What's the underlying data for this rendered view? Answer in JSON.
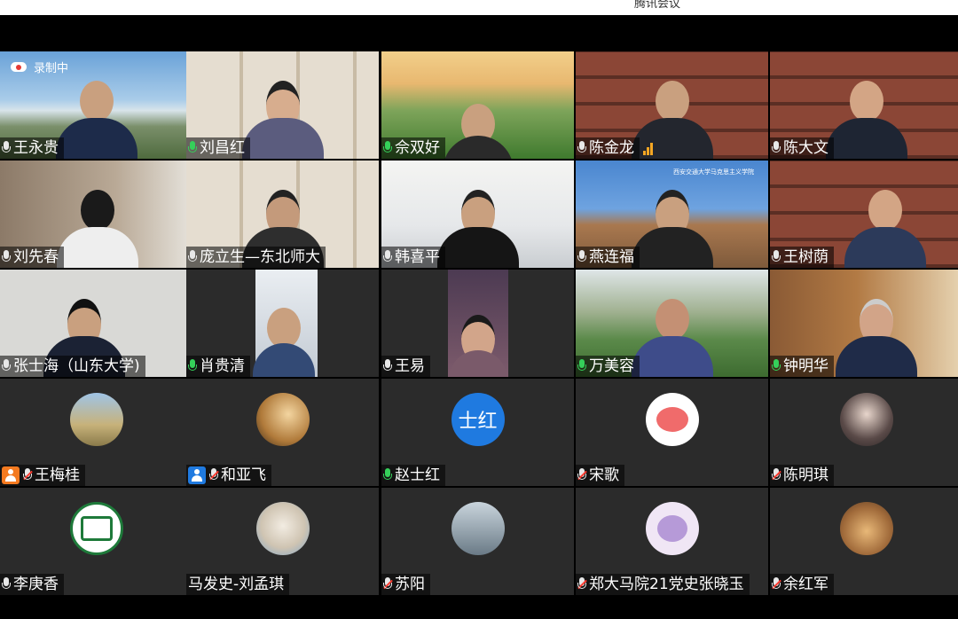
{
  "window": {
    "title": "腾讯会议"
  },
  "recording": {
    "label": "录制中"
  },
  "colors": {
    "mic_on": "#35d05a",
    "mic_muted_slash": "#ff3b30",
    "active_border": "#34d058",
    "empty_tile": "#2b2b2b",
    "badge_orange": "#f47a20",
    "badge_blue": "#1f7ae0"
  },
  "participants": [
    {
      "name": "王永贵",
      "mic": "off-white",
      "video": true
    },
    {
      "name": "刘昌红",
      "mic": "on",
      "video": true
    },
    {
      "name": "佘双好",
      "mic": "on",
      "video": true
    },
    {
      "name": "陈金龙",
      "mic": "off-white",
      "video": true
    },
    {
      "name": "陈大文",
      "mic": "off-white",
      "video": true
    },
    {
      "name": "刘先春",
      "mic": "off-white",
      "video": true
    },
    {
      "name": "庞立生—东北师大",
      "mic": "off-white",
      "video": true
    },
    {
      "name": "韩喜平",
      "mic": "off-white",
      "video": true,
      "active": true
    },
    {
      "name": "燕连福",
      "mic": "off-white",
      "video": true,
      "banner": "西安交通大学马克思主义学院"
    },
    {
      "name": "王树荫",
      "mic": "off-white",
      "video": true
    },
    {
      "name": "张士海（山东大学)",
      "mic": "off-white",
      "video": true
    },
    {
      "name": "肖贵清",
      "mic": "on",
      "video": true
    },
    {
      "name": "王易",
      "mic": "off-white",
      "video": true
    },
    {
      "name": "万美容",
      "mic": "on",
      "video": true
    },
    {
      "name": "钟明华",
      "mic": "on",
      "video": true
    },
    {
      "name": "王梅桂",
      "mic": "muted",
      "video": false,
      "avatar": "photo-landscape-icon",
      "badge": "orange"
    },
    {
      "name": "和亚飞",
      "mic": "muted",
      "video": false,
      "avatar": "photo-silhouette-icon",
      "badge": "blue"
    },
    {
      "name": "赵士红",
      "mic": "on",
      "video": false,
      "avatar_text": "士红",
      "avatar_color": "#1f7ae0"
    },
    {
      "name": "宋歌",
      "mic": "muted",
      "video": false,
      "avatar": "pig-sticker-icon"
    },
    {
      "name": "陈明琪",
      "mic": "muted",
      "video": false,
      "avatar": "photo-portrait-icon"
    },
    {
      "name": "李庚香",
      "mic": "off-white",
      "video": false,
      "avatar": "green-logo-icon"
    },
    {
      "name": "马发史-刘孟琪",
      "mic": "none",
      "video": false,
      "avatar": "alpaca-photo-icon"
    },
    {
      "name": "苏阳",
      "mic": "muted",
      "video": false,
      "avatar": "lake-photo-icon"
    },
    {
      "name": "郑大马院21党史张晓玉",
      "mic": "muted",
      "video": false,
      "avatar": "rabbit-cartoon-icon"
    },
    {
      "name": "余红军",
      "mic": "muted",
      "video": false,
      "avatar": "dinner-photo-icon"
    }
  ]
}
